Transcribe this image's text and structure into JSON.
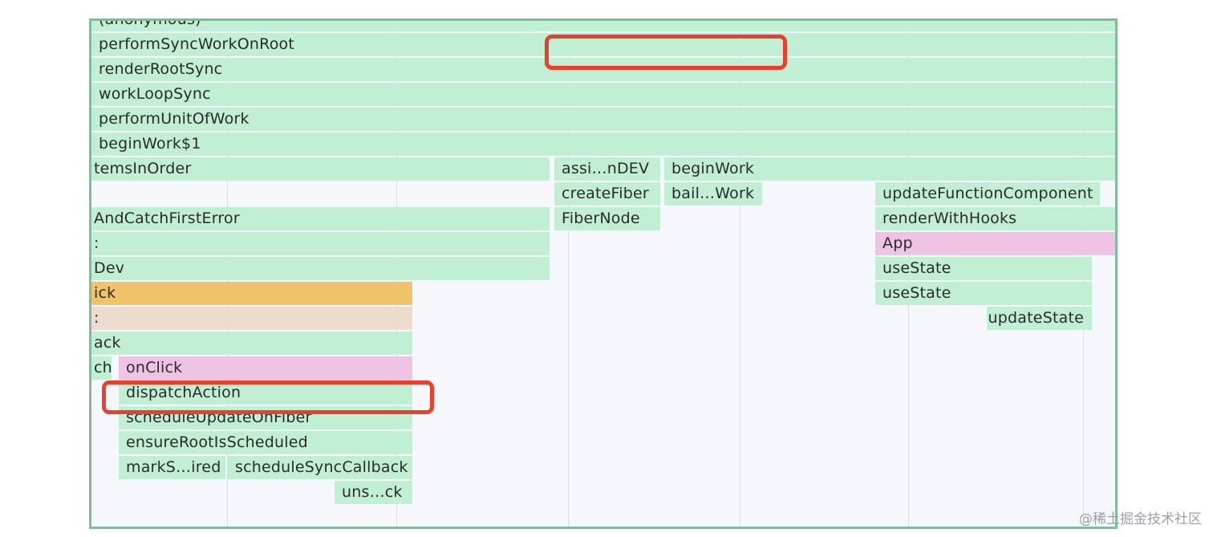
{
  "flame": {
    "frames": [
      {
        "label": "(anonymous)",
        "color": "green"
      },
      {
        "label": "performSyncWorkOnRoot",
        "color": "green"
      },
      {
        "label": "renderRootSync",
        "color": "green"
      },
      {
        "label": "workLoopSync",
        "color": "green"
      },
      {
        "label": "performUnitOfWork",
        "color": "green"
      },
      {
        "label": "beginWork$1",
        "color": "green"
      },
      {
        "label": "temsInOrder",
        "color": "green"
      },
      {
        "label": "assi…nDEV",
        "color": "green"
      },
      {
        "label": "beginWork",
        "color": "green"
      },
      {
        "label": "createFiber",
        "color": "green"
      },
      {
        "label": "bail…Work",
        "color": "green"
      },
      {
        "label": "updateFunctionComponent",
        "color": "green"
      },
      {
        "label": "AndCatchFirstError",
        "color": "green"
      },
      {
        "label": "FiberNode",
        "color": "green"
      },
      {
        "label": "renderWithHooks",
        "color": "green"
      },
      {
        "label": ":",
        "color": "green"
      },
      {
        "label": "App",
        "color": "pink"
      },
      {
        "label": "Dev",
        "color": "green"
      },
      {
        "label": "useState",
        "color": "green"
      },
      {
        "label": "ick",
        "color": "orange"
      },
      {
        "label": "useState",
        "color": "green"
      },
      {
        "label": ":",
        "color": "peach"
      },
      {
        "label": "updateState",
        "color": "green"
      },
      {
        "label": "ack",
        "color": "green"
      },
      {
        "label": "ch",
        "color": "green"
      },
      {
        "label": "onClick",
        "color": "pink"
      },
      {
        "label": "dispatchAction",
        "color": "green"
      },
      {
        "label": "scheduleUpdateOnFiber",
        "color": "green"
      },
      {
        "label": "ensureRootIsScheduled",
        "color": "green"
      },
      {
        "label": "markS…ired",
        "color": "green"
      },
      {
        "label": "scheduleSyncCallback",
        "color": "green"
      },
      {
        "label": "uns…ck",
        "color": "green"
      }
    ],
    "highlighted": [
      "performSyncWorkOnRoot",
      "dispatchAction"
    ]
  },
  "watermark": "@稀土掘金技术社区"
}
